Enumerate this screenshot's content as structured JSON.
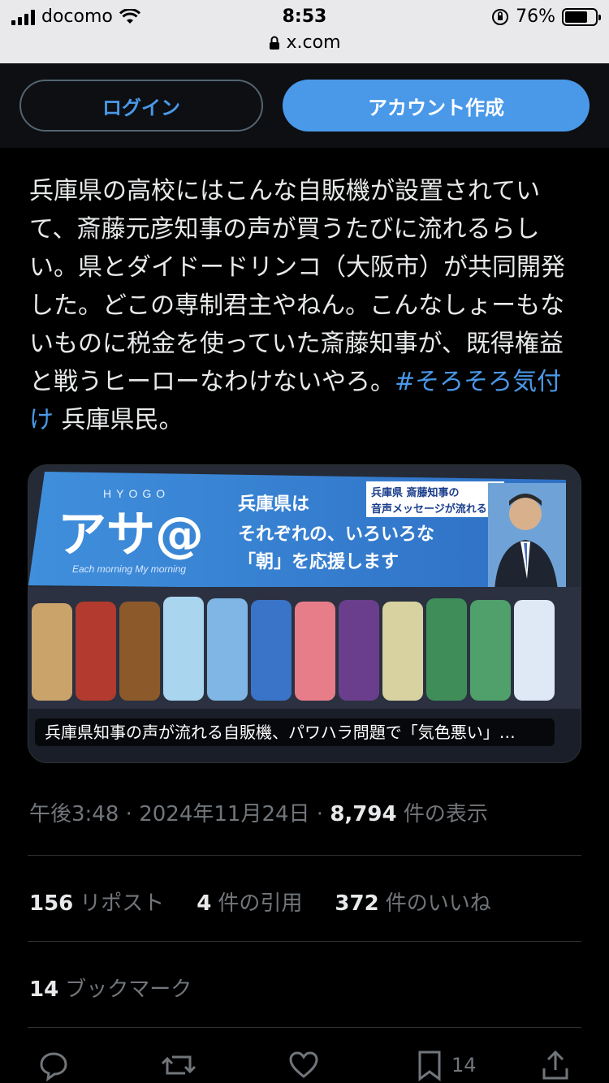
{
  "status_bar": {
    "carrier": "docomo",
    "time": "8:53",
    "battery": "76%",
    "battery_level": 0.76
  },
  "browser": {
    "url": "x.com"
  },
  "header": {
    "login_label": "ログイン",
    "signup_label": "アカウント作成"
  },
  "tweet": {
    "text": "兵庫県の高校にはこんな自販機が設置されていて、斎藤元彦知事の声が買うたびに流れるらしい。県とダイドードリンコ（大阪市）が共同開発した。どこの専制君主やねん。こんなしょーもないものに税金を使っていた斎藤知事が、既得権益と戦うヒーローなわけないやろ。",
    "hashtag": "#そろそろ気付け",
    "suffix": " 兵庫県民。"
  },
  "media": {
    "caption": "兵庫県知事の声が流れる自販機、パワハラ問題で「気色悪い」…",
    "banner_brand": "アサ@",
    "banner_hyogo": "HYOGO",
    "banner_sub": "Each morning My morning",
    "banner_line1": "兵庫県は",
    "banner_line2": "それぞれの、いろいろな",
    "banner_line3": "「朝」を応援します",
    "banner_tag1": "兵庫県 斎藤知事の",
    "banner_tag2": "音声メッセージが流れる！"
  },
  "meta": {
    "time": "午後3:48",
    "date": "2024年11月24日",
    "views": "8,794",
    "views_label": "件の表示"
  },
  "stats": {
    "reposts": "156",
    "reposts_label": "リポスト",
    "quotes": "4",
    "quotes_label": "件の引用",
    "likes": "372",
    "likes_label": "件のいいね"
  },
  "bookmarks": {
    "count": "14",
    "label": "ブックマーク"
  },
  "actions": {
    "bookmark_count": "14"
  }
}
